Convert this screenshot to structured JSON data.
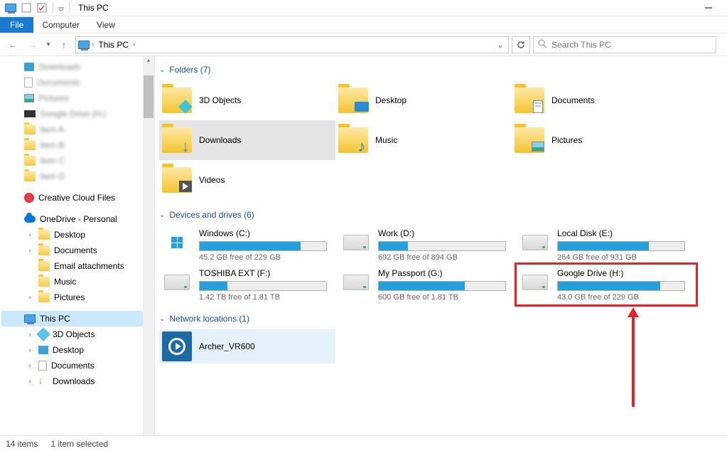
{
  "title_bar": {
    "title": "This PC"
  },
  "ribbon": {
    "file": "File",
    "computer": "Computer",
    "view": "View"
  },
  "nav": {
    "breadcrumb": "This PC",
    "search_placeholder": "Search This PC"
  },
  "sidebar": {
    "blurred": [
      "Downloads",
      "Documents",
      "Pictures",
      "Google Drive (H:)",
      "Item A",
      "Item B",
      "Item C",
      "Item D"
    ],
    "creative_cloud": "Creative Cloud Files",
    "onedrive": "OneDrive - Personal",
    "desktop": "Desktop",
    "documents": "Documents",
    "email": "Email attachments",
    "music": "Music",
    "pictures": "Pictures",
    "this_pc": "This PC",
    "objects3d": "3D Objects",
    "desktop2": "Desktop",
    "documents2": "Documents",
    "downloads2": "Downloads"
  },
  "sections": {
    "folders_label": "Folders (7)",
    "drives_label": "Devices and drives (6)",
    "network_label": "Network locations (1)"
  },
  "folders": [
    {
      "name": "3D Objects",
      "overlay": "3d"
    },
    {
      "name": "Desktop",
      "overlay": "desktop"
    },
    {
      "name": "Documents",
      "overlay": "doc"
    },
    {
      "name": "Downloads",
      "overlay": "download",
      "selected": true
    },
    {
      "name": "Music",
      "overlay": "music"
    },
    {
      "name": "Pictures",
      "overlay": "picture"
    },
    {
      "name": "Videos",
      "overlay": "video"
    }
  ],
  "drives": [
    {
      "name": "Windows (C:)",
      "free": "45.2 GB free of 229 GB",
      "pct": 80,
      "os": true
    },
    {
      "name": "Work (D:)",
      "free": "692 GB free of 894 GB",
      "pct": 23
    },
    {
      "name": "Local Disk (E:)",
      "free": "264 GB free of 931 GB",
      "pct": 72
    },
    {
      "name": "TOSHIBA EXT (F:)",
      "free": "1.42 TB free of 1.81 TB",
      "pct": 22
    },
    {
      "name": "My Passport (G:)",
      "free": "600 GB free of 1.81 TB",
      "pct": 68
    },
    {
      "name": "Google Drive (H:)",
      "free": "43.0 GB free of 229 GB",
      "pct": 81,
      "highlight": true
    }
  ],
  "network": [
    {
      "name": "Archer_VR600"
    }
  ],
  "status": {
    "items": "14 items",
    "selected": "1 item selected"
  }
}
